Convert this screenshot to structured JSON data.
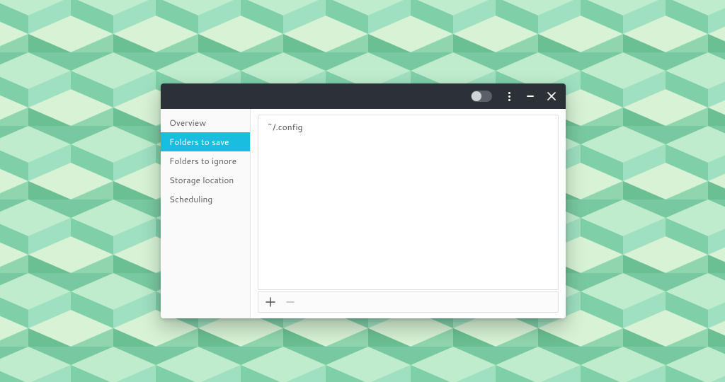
{
  "colors": {
    "titlebar": "#2b3136",
    "accent": "#19bde0",
    "bg_a": "#9ee0c0",
    "bg_b": "#7fcfa9",
    "bg_c": "#bfeccd",
    "bg_d": "#d7f2d5",
    "bg_e": "#6abf93"
  },
  "titlebar": {
    "toggle_on": false
  },
  "sidebar": {
    "items": [
      {
        "label": "Overview",
        "active": false
      },
      {
        "label": "Folders to save",
        "active": true
      },
      {
        "label": "Folders to ignore",
        "active": false
      },
      {
        "label": "Storage location",
        "active": false
      },
      {
        "label": "Scheduling",
        "active": false
      }
    ]
  },
  "folders_to_save": {
    "rows": [
      {
        "path": "~/.config"
      }
    ]
  },
  "toolbar": {
    "add_enabled": true,
    "remove_enabled": false
  }
}
